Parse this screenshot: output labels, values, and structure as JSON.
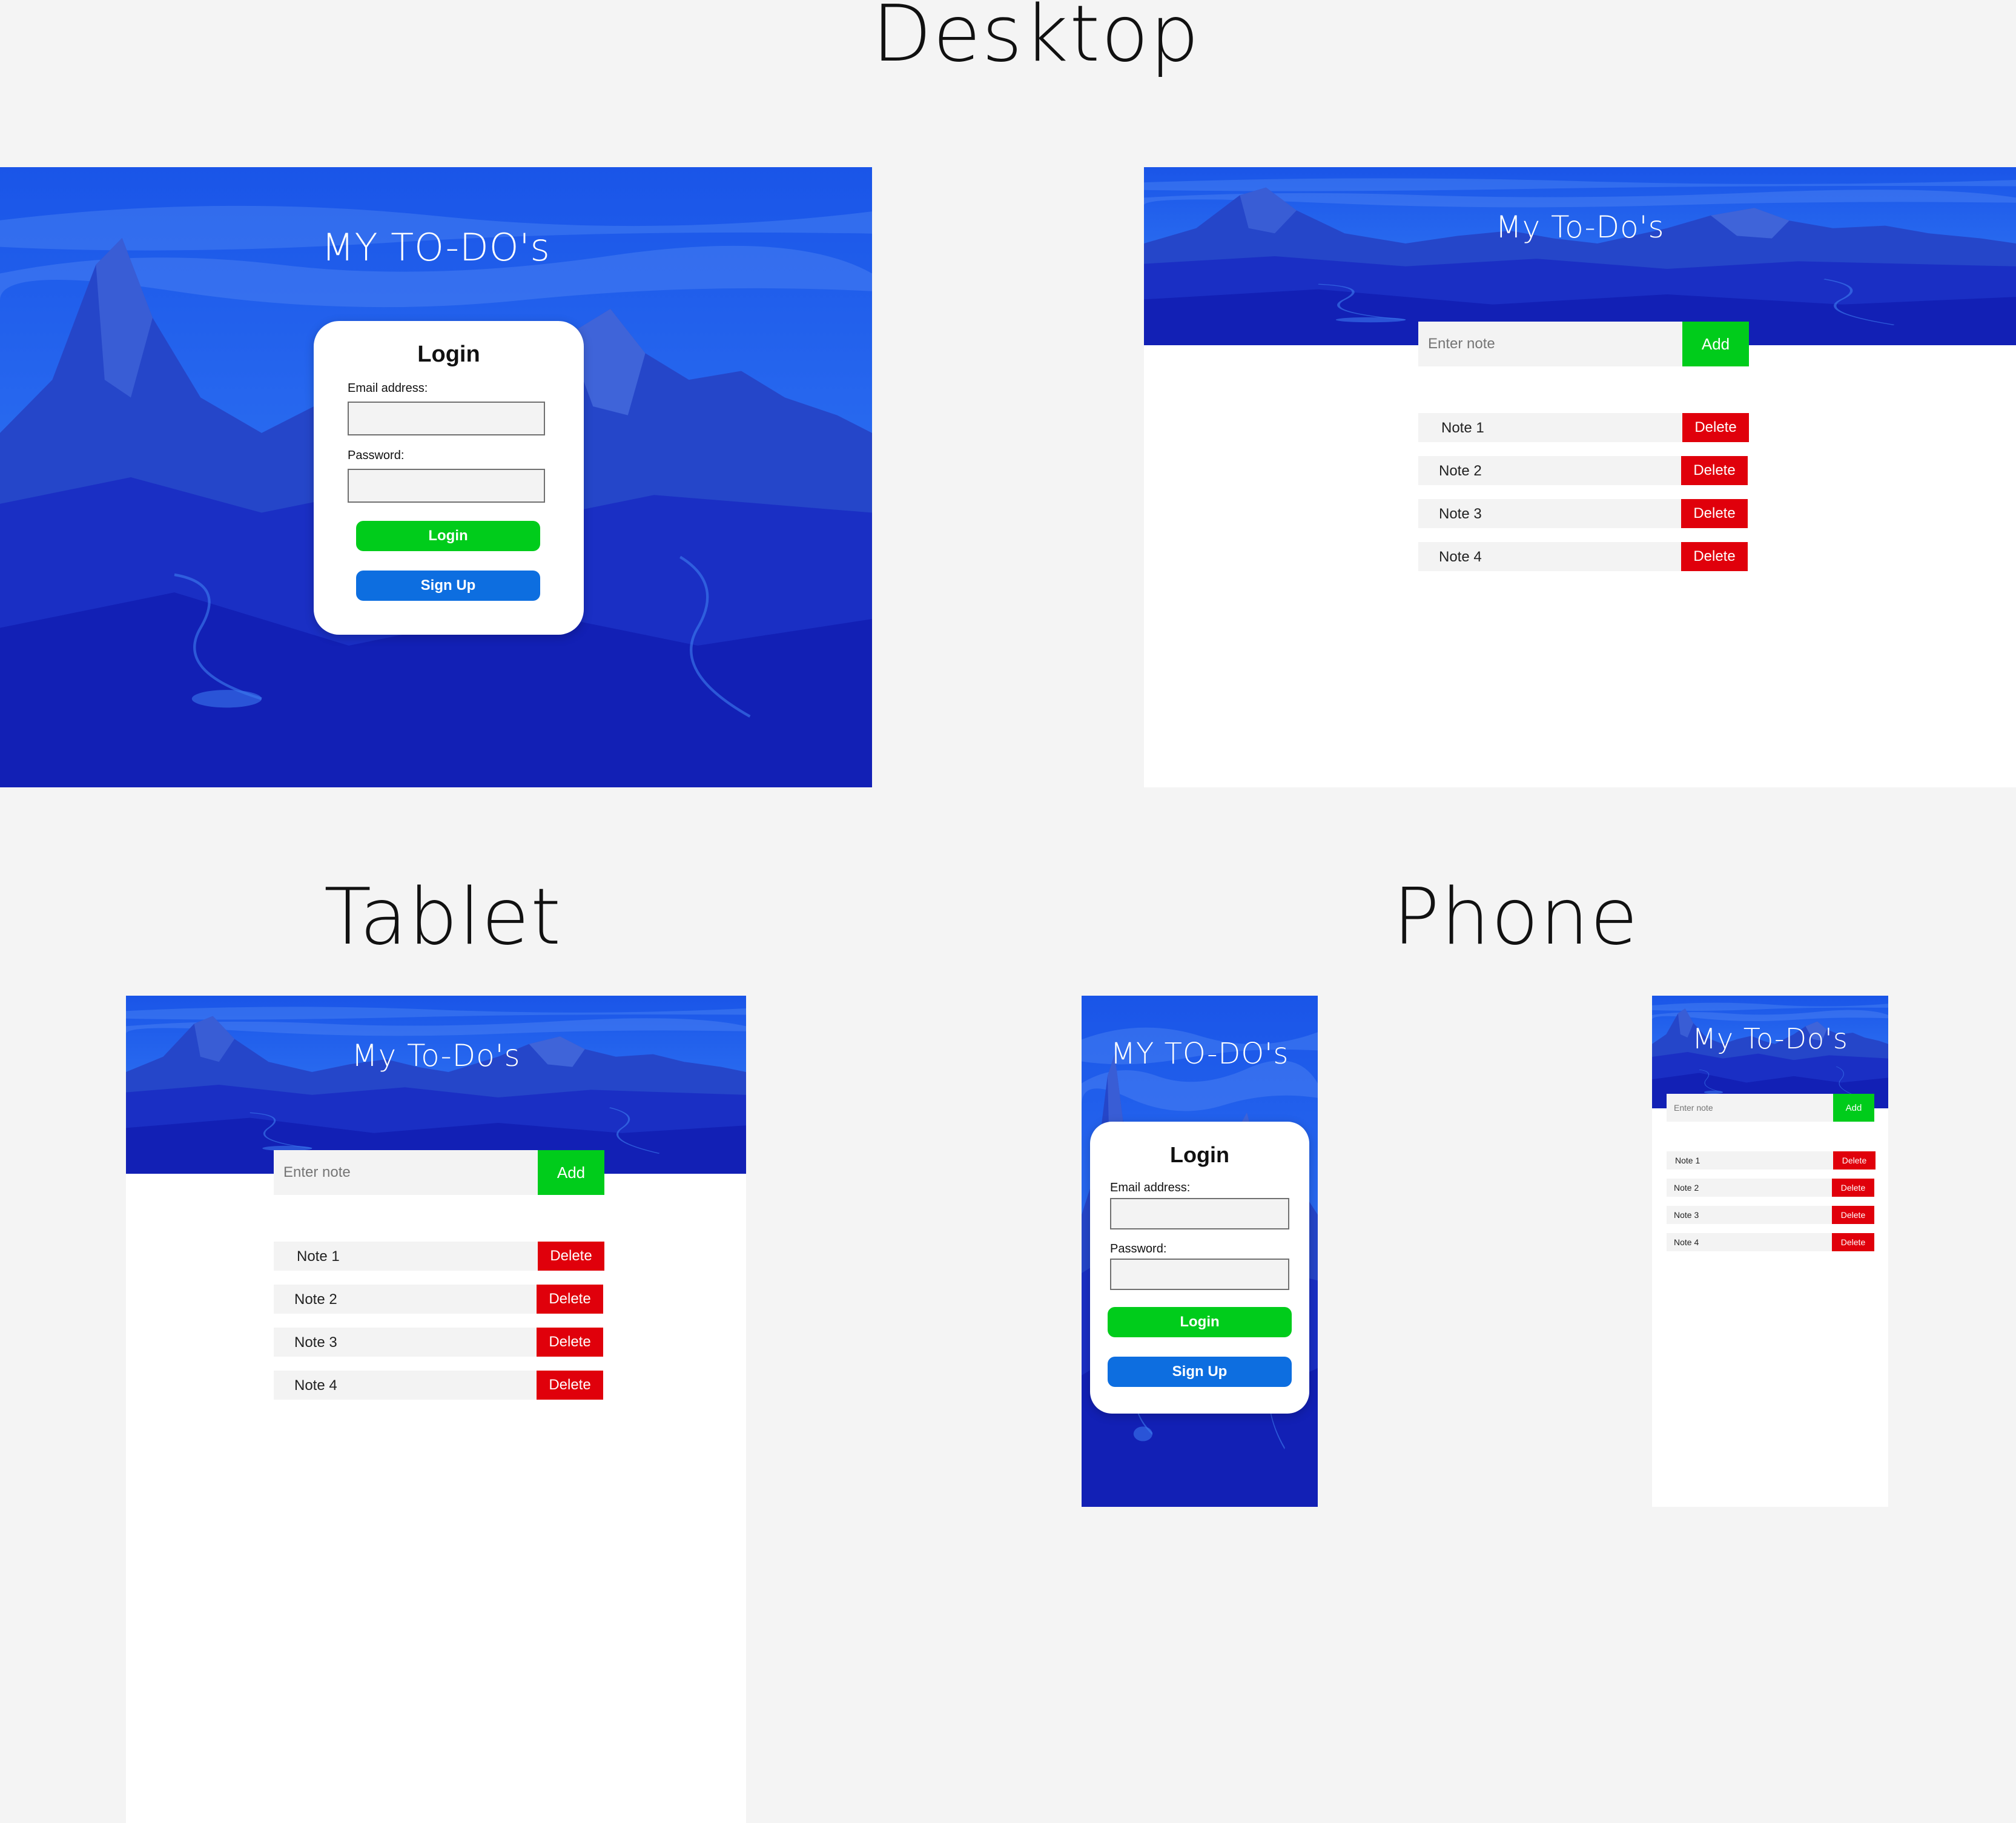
{
  "sections": {
    "desktop": "Desktop",
    "tablet": "Tablet",
    "phone": "Phone"
  },
  "colors": {
    "sky": "#1c4fe0",
    "mountain_dark": "#1020c0",
    "add_green": "#00cc1b",
    "delete_red": "#e0000b",
    "signup_blue": "#0d6ee0",
    "page_bg": "#f4f4f4"
  },
  "login": {
    "app_title": "MY TO-DO's",
    "card_title": "Login",
    "email_label": "Email address:",
    "password_label": "Password:",
    "login_button": "Login",
    "signup_button": "Sign Up"
  },
  "notes_app": {
    "app_title": "My To-Do's",
    "input_placeholder": "Enter note",
    "add_button": "Add",
    "delete_button": "Delete",
    "notes": [
      "Note 1",
      "Note 2",
      "Note 3",
      "Note 4"
    ]
  }
}
